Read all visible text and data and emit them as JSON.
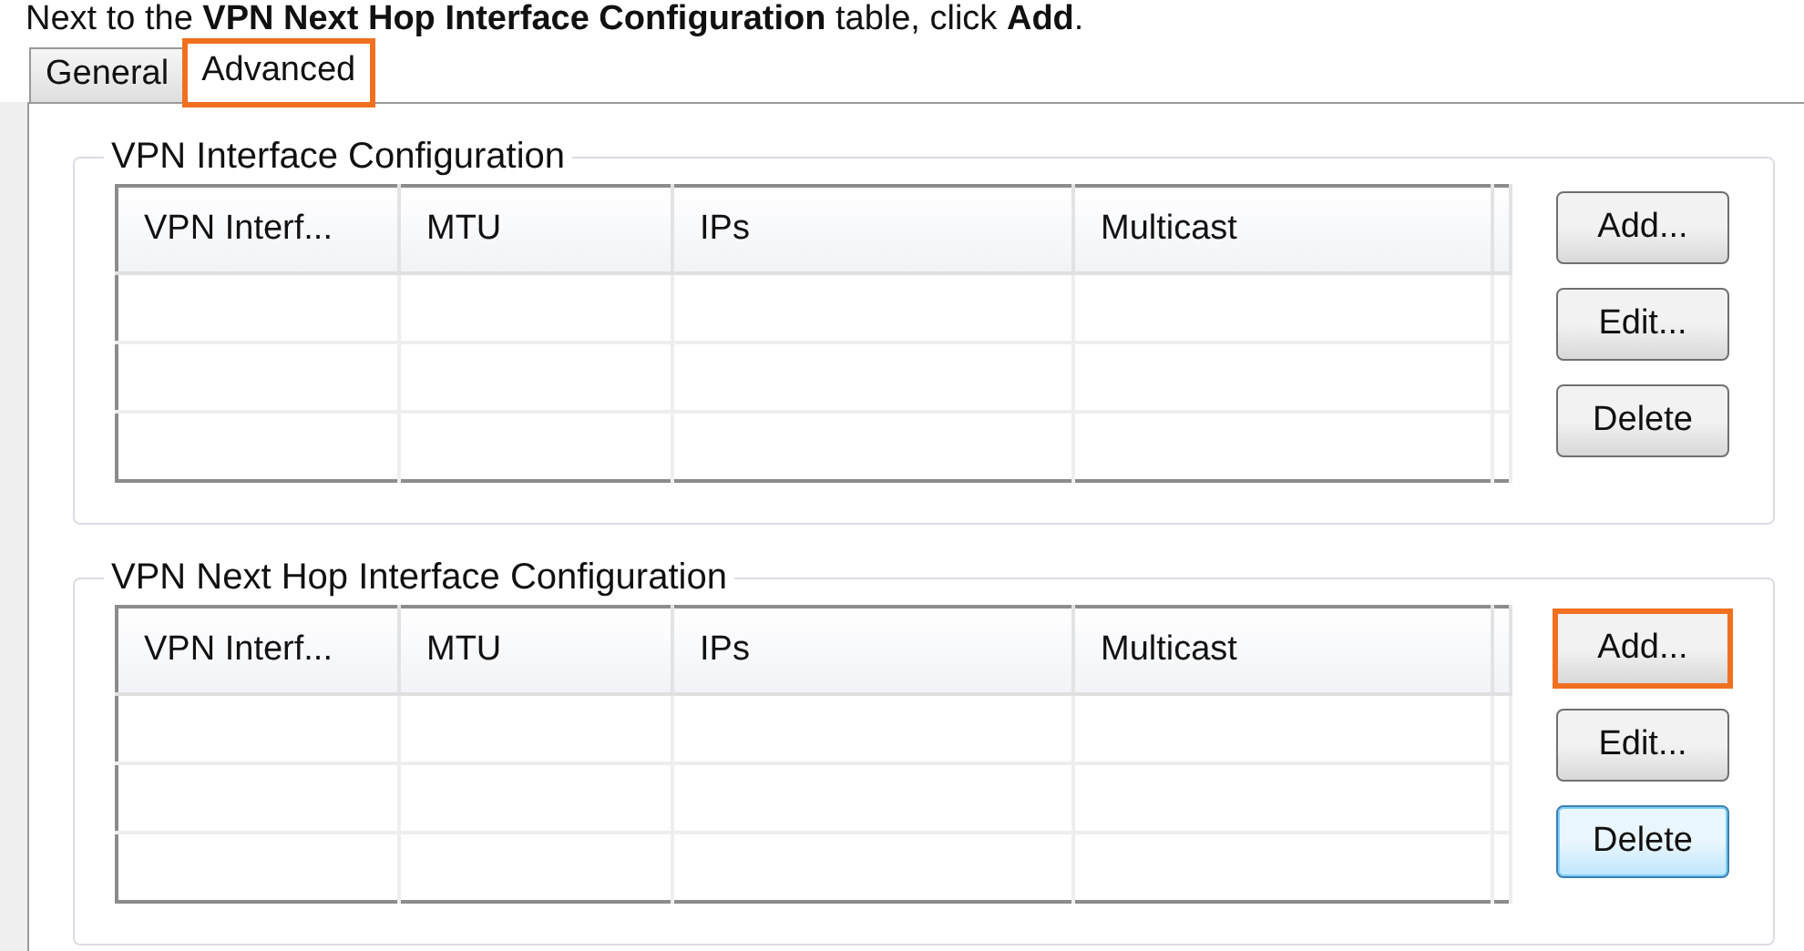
{
  "instruction": "Next to the **VPN Next Hop Interface Configuration** table, click **Add**.",
  "tabs": [
    {
      "label": "General",
      "selected": false,
      "highlighted": false
    },
    {
      "label": "Advanced",
      "selected": true,
      "highlighted": true
    }
  ],
  "groups": [
    {
      "title": "VPN Interface Configuration",
      "columns": [
        "VPN Interf...",
        "MTU",
        "IPs",
        "Multicast"
      ],
      "buttons": [
        {
          "label": "Add...",
          "highlighted": false,
          "focused": false
        },
        {
          "label": "Edit...",
          "highlighted": false,
          "focused": false
        },
        {
          "label": "Delete",
          "highlighted": false,
          "focused": false
        }
      ]
    },
    {
      "title": "VPN Next Hop Interface Configuration",
      "columns": [
        "VPN Interf...",
        "MTU",
        "IPs",
        "Multicast"
      ],
      "buttons": [
        {
          "label": "Add...",
          "highlighted": true,
          "focused": false
        },
        {
          "label": "Edit...",
          "highlighted": false,
          "focused": false
        },
        {
          "label": "Delete",
          "highlighted": false,
          "focused": true
        }
      ]
    }
  ]
}
